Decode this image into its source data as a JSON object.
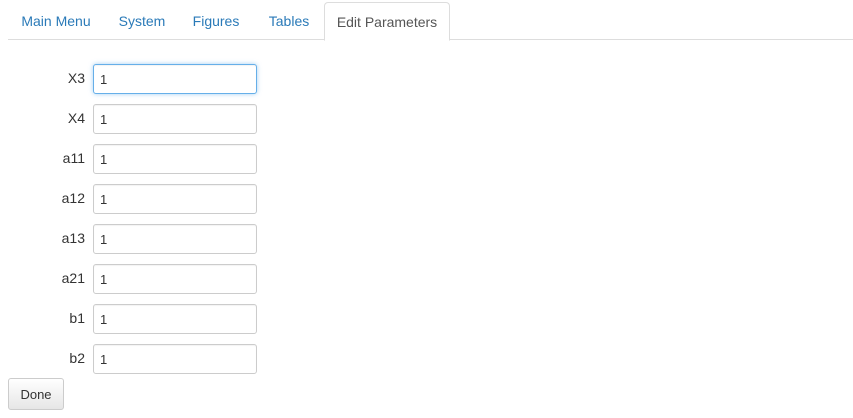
{
  "tabs": [
    {
      "label": "Main Menu"
    },
    {
      "label": "System"
    },
    {
      "label": "Figures"
    },
    {
      "label": "Tables"
    },
    {
      "label": "Edit Parameters"
    }
  ],
  "active_tab": "Edit Parameters",
  "parameters": [
    {
      "label": "X3",
      "value": "1"
    },
    {
      "label": "X4",
      "value": "1"
    },
    {
      "label": "a11",
      "value": "1"
    },
    {
      "label": "a12",
      "value": "1"
    },
    {
      "label": "a13",
      "value": "1"
    },
    {
      "label": "a21",
      "value": "1"
    },
    {
      "label": "b1",
      "value": "1"
    },
    {
      "label": "b2",
      "value": "1"
    }
  ],
  "done_label": "Done",
  "colors": {
    "link": "#2a7ab8",
    "active_tab_text": "#555555",
    "focus_border": "#66afe9"
  }
}
